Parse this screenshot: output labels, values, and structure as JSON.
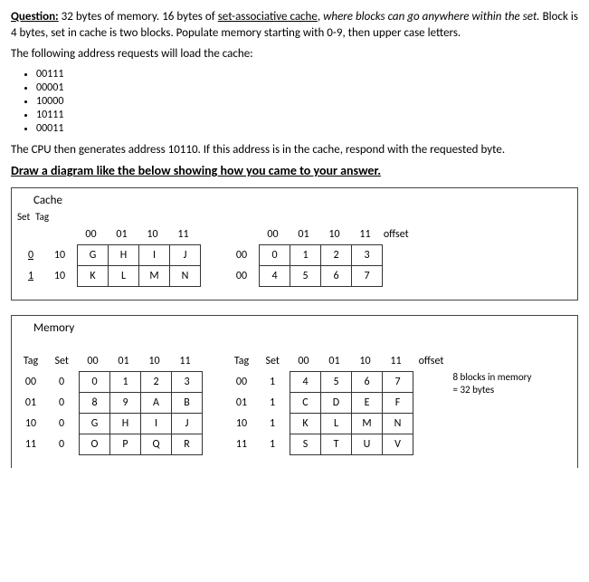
{
  "question": {
    "label": "Question:",
    "body_a": "32 bytes of memory.   16 bytes of ",
    "set_assoc": "set-associative cache",
    "body_b": ", ",
    "italic_phrase": "where blocks can go anywhere within the set.",
    "body_c": "  Block is 4 bytes, set in cache is two blocks.  Populate memory starting with 0-9, then upper case letters.",
    "line2": "The following address requests will load the cache:",
    "addresses": [
      "00111",
      "00001",
      "10000",
      "10111",
      "00011"
    ],
    "line3": "The CPU then generates address 10110.   If this address is in the cache, respond with the requested byte.",
    "draw_heading": "Draw a diagram like the below showing how you came to your answer."
  },
  "cache": {
    "title": "Cache",
    "hdr_set": "Set",
    "hdr_tag": "Tag",
    "offsets": [
      "00",
      "01",
      "10",
      "11"
    ],
    "offset_label": "offset",
    "left": {
      "rows": [
        {
          "set": "0",
          "tag": "10",
          "cells": [
            "G",
            "H",
            "I",
            "J"
          ]
        },
        {
          "set": "1",
          "tag": "10",
          "cells": [
            "K",
            "L",
            "M",
            "N"
          ]
        }
      ]
    },
    "right": {
      "rows": [
        {
          "set": "",
          "tag": "00",
          "cells": [
            "0",
            "1",
            "2",
            "3"
          ]
        },
        {
          "set": "",
          "tag": "00",
          "cells": [
            "4",
            "5",
            "6",
            "7"
          ]
        }
      ]
    }
  },
  "memory": {
    "title": "Memory",
    "tag_label": "Tag",
    "set_label": "Set",
    "offsets": [
      "00",
      "01",
      "10",
      "11"
    ],
    "offset_label": "offset",
    "left": [
      {
        "tag": "00",
        "set": "0",
        "cells": [
          "0",
          "1",
          "2",
          "3"
        ]
      },
      {
        "tag": "01",
        "set": "0",
        "cells": [
          "8",
          "9",
          "A",
          "B"
        ]
      },
      {
        "tag": "10",
        "set": "0",
        "cells": [
          "G",
          "H",
          "I",
          "J"
        ]
      },
      {
        "tag": "11",
        "set": "0",
        "cells": [
          "O",
          "P",
          "Q",
          "R"
        ]
      }
    ],
    "right": [
      {
        "tag": "00",
        "set": "1",
        "cells": [
          "4",
          "5",
          "6",
          "7"
        ]
      },
      {
        "tag": "01",
        "set": "1",
        "cells": [
          "C",
          "D",
          "E",
          "F"
        ]
      },
      {
        "tag": "10",
        "set": "1",
        "cells": [
          "K",
          "L",
          "M",
          "N"
        ]
      },
      {
        "tag": "11",
        "set": "1",
        "cells": [
          "S",
          "T",
          "U",
          "V"
        ]
      }
    ],
    "note_a": "8 blocks in memory",
    "note_b": "= 32 bytes"
  }
}
